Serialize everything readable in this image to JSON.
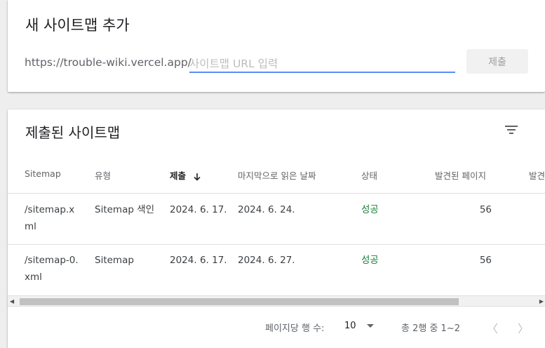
{
  "add_sitemap": {
    "title": "새 사이트맵 추가",
    "url_prefix": "https://trouble-wiki.vercel.app/",
    "input_placeholder": "사이트맵 URL 입력",
    "input_value": "",
    "submit_label": "제출"
  },
  "submitted": {
    "title": "제출된 사이트맵",
    "filter_icon": "filter-list-icon",
    "columns": [
      "Sitemap",
      "유형",
      "제출",
      "마지막으로 읽은 날짜",
      "상태",
      "발견된 페이지",
      "발견"
    ],
    "sorted_column": "제출",
    "sort_direction": "descending",
    "rows": [
      {
        "sitemap_line1": "/sitemap.x",
        "sitemap_line2": "ml",
        "type": "Sitemap 색인",
        "submitted": "2024. 6. 17.",
        "last_read": "2024. 6. 24.",
        "status": "성공",
        "pages": "56"
      },
      {
        "sitemap_line1": "/sitemap-0.",
        "sitemap_line2": "xml",
        "type": "Sitemap",
        "submitted": "2024. 6. 17.",
        "last_read": "2024. 6. 27.",
        "status": "성공",
        "pages": "56"
      }
    ],
    "horizontal_scroll_fraction": 0.0
  },
  "pagination": {
    "rows_per_page_label": "페이지당 행 수:",
    "rows_per_page_value": "10",
    "range_text": "총 2행 중 1~2",
    "prev_icon": "chevron-left-icon",
    "next_icon": "chevron-right-icon"
  },
  "colors": {
    "accent": "#5b8df5",
    "success": "#188038",
    "text_secondary": "#5f6368"
  }
}
